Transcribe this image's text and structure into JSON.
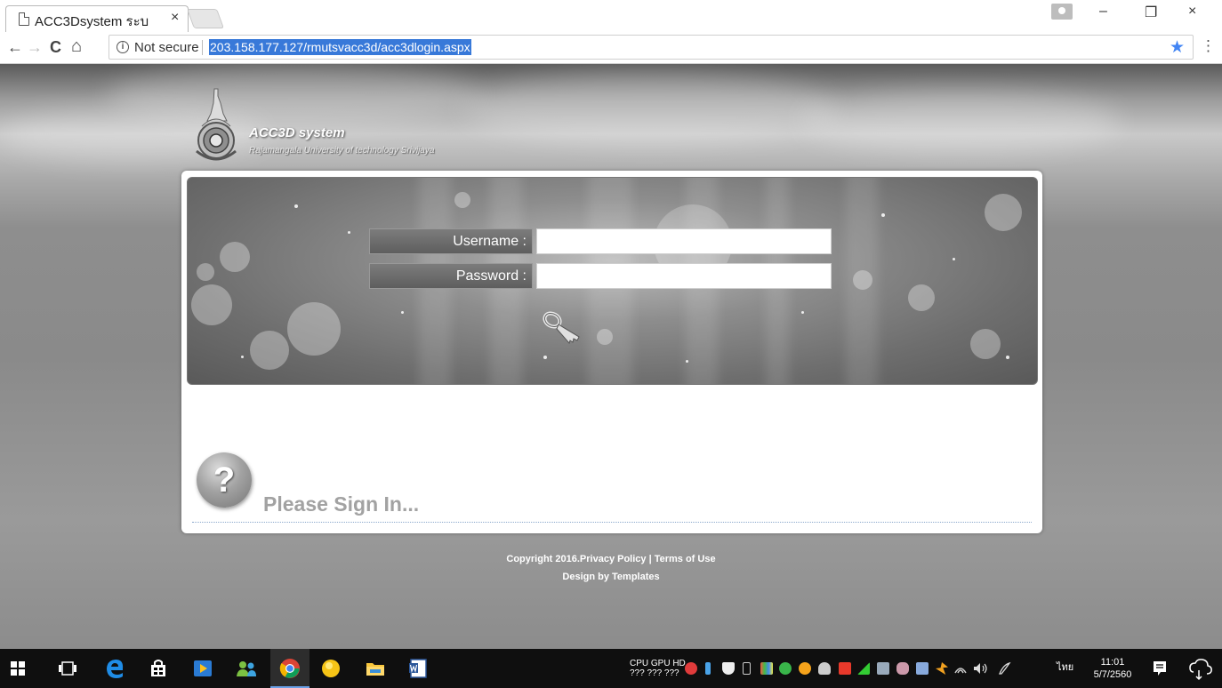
{
  "browser": {
    "tab_title": "ACC3Dsystem ระบ",
    "tab_close": "×",
    "security_label": "Not secure",
    "url": "203.158.177.127/rmutsvacc3d/acc3dlogin.aspx",
    "window_controls": {
      "minimize": "–",
      "restore": "❐",
      "close": "×"
    },
    "nav": {
      "back": "←",
      "forward": "→",
      "reload": "C",
      "home": "⌂",
      "info": "i",
      "star": "★",
      "menu": "⋮"
    }
  },
  "site": {
    "title": "ACC3D system",
    "subtitle": "Rajamangala University of technology Srivijaya"
  },
  "login": {
    "username_label": "Username :",
    "username_value": "",
    "password_label": "Password :",
    "password_value": "",
    "submit_icon": "key-icon"
  },
  "help": {
    "icon_glyph": "?",
    "message": "Please Sign In..."
  },
  "footer": {
    "line1": "Copyright 2016.Privacy Policy | Terms of Use",
    "line2": "Design by Templates"
  },
  "taskbar": {
    "perf_labels": "CPU GPU HD",
    "perf_values": "??? ??? ???",
    "language": "ไทย",
    "time": "11:01",
    "date": "5/7/2560"
  }
}
